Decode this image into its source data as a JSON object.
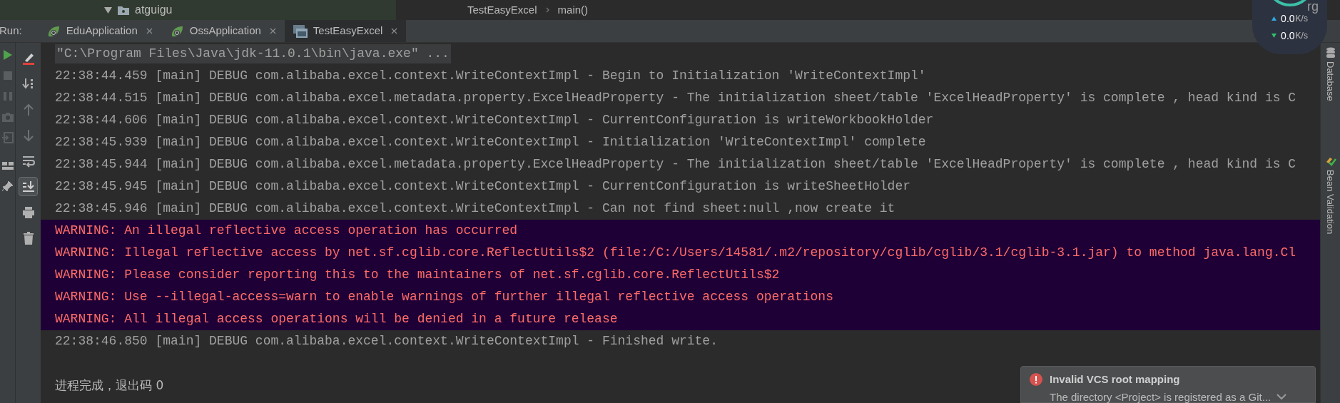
{
  "project_tree": {
    "expanded": true,
    "folder": "atguigu"
  },
  "breadcrumb": [
    "TestEasyExcel",
    "main()"
  ],
  "editor_fragment": "rg",
  "run_panel": {
    "label": "Run:",
    "tabs": [
      {
        "label": "EduApplication",
        "kind": "spring",
        "selected": false
      },
      {
        "label": "OssApplication",
        "kind": "spring",
        "selected": false
      },
      {
        "label": "TestEasyExcel",
        "kind": "app",
        "selected": true
      }
    ]
  },
  "run_tools": [
    {
      "disabled": false
    },
    {
      "disabled": true
    },
    {
      "disabled": true
    },
    {
      "disabled": true
    },
    {
      "disabled": true
    },
    {
      "disabled": false
    },
    {
      "disabled": false
    }
  ],
  "console_tools": [
    {
      "selected": false
    },
    {
      "selected": false
    },
    {
      "selected": false
    },
    {
      "selected": false
    },
    {
      "selected": false
    },
    {
      "selected": true
    },
    {
      "selected": false
    },
    {
      "selected": false
    }
  ],
  "console_lines": [
    {
      "kind": "command",
      "text": "\"C:\\Program Files\\Java\\jdk-11.0.1\\bin\\java.exe\" ..."
    },
    {
      "kind": "debug",
      "text": "22:38:44.459 [main] DEBUG com.alibaba.excel.context.WriteContextImpl - Begin to Initialization 'WriteContextImpl'"
    },
    {
      "kind": "debug",
      "text": "22:38:44.515 [main] DEBUG com.alibaba.excel.metadata.property.ExcelHeadProperty - The initialization sheet/table 'ExcelHeadProperty' is complete , head kind is C"
    },
    {
      "kind": "debug",
      "text": "22:38:44.606 [main] DEBUG com.alibaba.excel.context.WriteContextImpl - CurrentConfiguration is writeWorkbookHolder"
    },
    {
      "kind": "debug",
      "text": "22:38:45.939 [main] DEBUG com.alibaba.excel.context.WriteContextImpl - Initialization 'WriteContextImpl' complete"
    },
    {
      "kind": "debug",
      "text": "22:38:45.944 [main] DEBUG com.alibaba.excel.metadata.property.ExcelHeadProperty - The initialization sheet/table 'ExcelHeadProperty' is complete , head kind is C"
    },
    {
      "kind": "debug",
      "text": "22:38:45.945 [main] DEBUG com.alibaba.excel.context.WriteContextImpl - CurrentConfiguration is writeSheetHolder"
    },
    {
      "kind": "debug",
      "text": "22:38:45.946 [main] DEBUG com.alibaba.excel.context.WriteContextImpl - Can not find sheet:null ,now create it"
    },
    {
      "kind": "warning",
      "text": "WARNING: An illegal reflective access operation has occurred"
    },
    {
      "kind": "warning",
      "text": "WARNING: Illegal reflective access by net.sf.cglib.core.ReflectUtils$2 (file:/C:/Users/14581/.m2/repository/cglib/cglib/3.1/cglib-3.1.jar) to method java.lang.Cl"
    },
    {
      "kind": "warning",
      "text": "WARNING: Please consider reporting this to the maintainers of net.sf.cglib.core.ReflectUtils$2"
    },
    {
      "kind": "warning",
      "text": "WARNING: Use --illegal-access=warn to enable warnings of further illegal reflective access operations"
    },
    {
      "kind": "warning",
      "text": "WARNING: All illegal access operations will be denied in a future release"
    },
    {
      "kind": "debug",
      "text": "22:38:46.850 [main] DEBUG com.alibaba.excel.context.WriteContextImpl - Finished write."
    },
    {
      "kind": "blank"
    },
    {
      "kind": "exit",
      "text": "进程完成，退出码 0"
    }
  ],
  "network": [
    {
      "kind": "upload",
      "value": "0.0",
      "unit": "K/s"
    },
    {
      "kind": "download",
      "value": "0.0",
      "unit": "K/s"
    }
  ],
  "side_tools": [
    "Database",
    "Bean Validation"
  ],
  "notification": {
    "title": "Invalid VCS root mapping",
    "body": "The directory <Project> is registered as a Git..."
  }
}
